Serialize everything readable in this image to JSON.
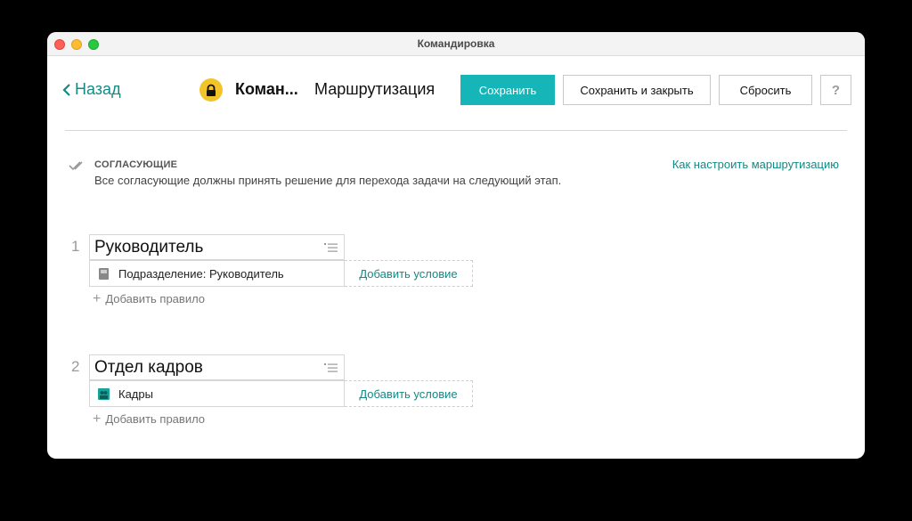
{
  "window": {
    "title": "Командировка"
  },
  "header": {
    "back_label": "Назад",
    "doc_title": "Коман...",
    "section_title": "Маршрутизация",
    "save_label": "Сохранить",
    "save_close_label": "Сохранить и закрыть",
    "reset_label": "Сбросить",
    "help_label": "?"
  },
  "approvers": {
    "heading": "СОГЛАСУЮЩИЕ",
    "description": "Все согласующие должны принять решение для перехода задачи на следующий этап.",
    "help_link": "Как настроить маршрутизацию"
  },
  "stages": [
    {
      "number": "1",
      "name": "Руководитель",
      "rule": "Подразделение: Руководитель",
      "rule_icon": "department-book-icon",
      "add_condition": "Добавить условие",
      "add_rule": "Добавить правило"
    },
    {
      "number": "2",
      "name": "Отдел кадров",
      "rule": "Кадры",
      "rule_icon": "group-icon",
      "add_condition": "Добавить условие",
      "add_rule": "Добавить правило"
    }
  ],
  "colors": {
    "accent": "#15b5b8",
    "link": "#138a84",
    "lock": "#f3c32a"
  }
}
